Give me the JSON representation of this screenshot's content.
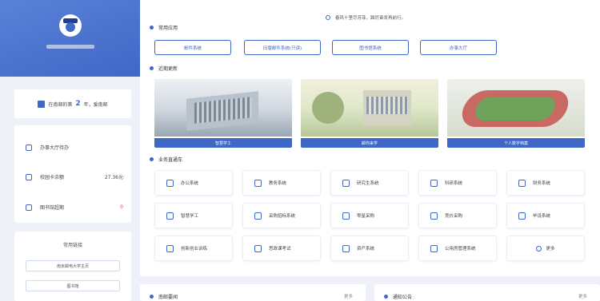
{
  "sidebar": {
    "days_prefix": "在南邮的第",
    "days_num": "2",
    "days_suffix": "年，爱南邮",
    "stats": [
      {
        "icon": "clock-icon",
        "label": "办事大厅待办",
        "value": ""
      },
      {
        "icon": "wallet-icon",
        "label": "校园卡余额",
        "value": "27.36元"
      },
      {
        "icon": "book-icon",
        "label": "图书馆超期",
        "value": "0"
      }
    ],
    "links_title": "常用链接",
    "links": [
      "南京邮电大学主页",
      "图书馆"
    ]
  },
  "notice": "春风十里尽芳菲，踔厉奋发再前行。",
  "sections": {
    "common_apps": "常用应用",
    "recent": "近期更新",
    "services": "业务直通车"
  },
  "quick_apps": [
    "邮件系统",
    "旧版邮件系统(只读)",
    "图书馆系统",
    "办事大厅"
  ],
  "banners": [
    "智慧学工",
    "邮你来学",
    "个人数字档案"
  ],
  "services": [
    {
      "icon": "monitor-icon",
      "label": "办公系统"
    },
    {
      "icon": "book-icon",
      "label": "教务系统"
    },
    {
      "icon": "graduation-cap-icon",
      "label": "研究生系统"
    },
    {
      "icon": "cube-icon",
      "label": "科研系统"
    },
    {
      "icon": "finance-icon",
      "label": "财务系统"
    },
    {
      "icon": "person-icon",
      "label": "智慧学工"
    },
    {
      "icon": "cube-icon",
      "label": "采购招标系统"
    },
    {
      "icon": "cube-icon",
      "label": "零星采购"
    },
    {
      "icon": "cart-icon",
      "label": "竞价采购"
    },
    {
      "icon": "grid-icon",
      "label": "毕设系统"
    },
    {
      "icon": "bulb-icon",
      "label": "创新创业训练"
    },
    {
      "icon": "exam-icon",
      "label": "思政课考试"
    },
    {
      "icon": "cube-icon",
      "label": "资产系统"
    },
    {
      "icon": "building-icon",
      "label": "公用房管理系统"
    },
    {
      "icon": "more-icon",
      "label": "更多"
    }
  ],
  "bottom": {
    "news_title": "南邮要闻",
    "news_more": "更多",
    "notices_title": "通知公告",
    "notices_more": "更多"
  },
  "colors": {
    "accent": "#3f67c6",
    "danger": "#e03a3a"
  }
}
